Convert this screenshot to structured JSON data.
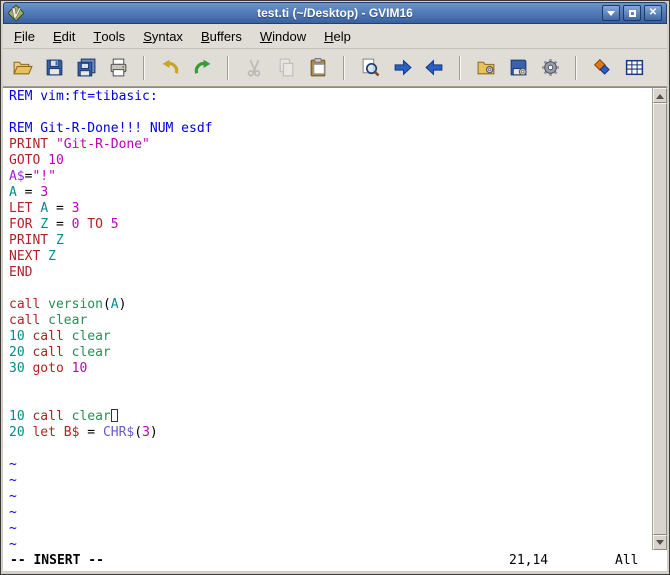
{
  "window": {
    "title": "test.ti (~/Desktop) - GVIM16",
    "controls": [
      "minimize",
      "maximize",
      "close"
    ]
  },
  "menu": {
    "items": [
      {
        "label": "File"
      },
      {
        "label": "Edit"
      },
      {
        "label": "Tools"
      },
      {
        "label": "Syntax"
      },
      {
        "label": "Buffers"
      },
      {
        "label": "Window"
      },
      {
        "label": "Help"
      }
    ]
  },
  "toolbar": {
    "icons": [
      "open-file-icon",
      "save-icon",
      "save-all-icon",
      "print-icon",
      "undo-icon",
      "redo-icon",
      "cut-icon",
      "copy-icon",
      "paste-icon",
      "find-replace-icon",
      "find-next-icon",
      "find-prev-icon",
      "load-session-icon",
      "save-session-icon",
      "run-script-icon",
      "make-icon",
      "table-icon"
    ]
  },
  "editor": {
    "cursor": {
      "line": 21,
      "col": 14
    },
    "tilde_rows": 6,
    "lines": [
      [
        {
          "t": "REM vim:ft=tibasic:",
          "c": "comment"
        }
      ],
      [],
      [
        {
          "t": "REM Git-R-Done!!! NUM esdf",
          "c": "comment"
        }
      ],
      [
        {
          "t": "PRINT ",
          "c": "statement"
        },
        {
          "t": "\"Git-R-Done\"",
          "c": "constant"
        }
      ],
      [
        {
          "t": "GOTO ",
          "c": "statement"
        },
        {
          "t": "10",
          "c": "constant"
        }
      ],
      [
        {
          "t": "A$",
          "c": "preproc"
        },
        {
          "t": "=",
          "c": "normal"
        },
        {
          "t": "\"!\"",
          "c": "constant"
        }
      ],
      [
        {
          "t": "A",
          "c": "identifier"
        },
        {
          "t": " = ",
          "c": "normal"
        },
        {
          "t": "3",
          "c": "constant"
        }
      ],
      [
        {
          "t": "LET ",
          "c": "statement"
        },
        {
          "t": "A",
          "c": "identifier"
        },
        {
          "t": " = ",
          "c": "normal"
        },
        {
          "t": "3",
          "c": "constant"
        }
      ],
      [
        {
          "t": "FOR ",
          "c": "statement"
        },
        {
          "t": "Z",
          "c": "identifier"
        },
        {
          "t": " = ",
          "c": "normal"
        },
        {
          "t": "0",
          "c": "constant"
        },
        {
          "t": " ",
          "c": "normal"
        },
        {
          "t": "TO ",
          "c": "statement"
        },
        {
          "t": "5",
          "c": "constant"
        }
      ],
      [
        {
          "t": "PRINT ",
          "c": "statement"
        },
        {
          "t": "Z",
          "c": "identifier"
        }
      ],
      [
        {
          "t": "NEXT ",
          "c": "statement"
        },
        {
          "t": "Z",
          "c": "identifier"
        }
      ],
      [
        {
          "t": "END",
          "c": "statement"
        }
      ],
      [],
      [
        {
          "t": "call ",
          "c": "statement"
        },
        {
          "t": "version",
          "c": "function"
        },
        {
          "t": "(",
          "c": "normal"
        },
        {
          "t": "A",
          "c": "identifier"
        },
        {
          "t": ")",
          "c": "normal"
        }
      ],
      [
        {
          "t": "call ",
          "c": "statement"
        },
        {
          "t": "clear",
          "c": "function"
        }
      ],
      [
        {
          "t": "10 ",
          "c": "identifier"
        },
        {
          "t": "call ",
          "c": "statement"
        },
        {
          "t": "clear",
          "c": "function"
        }
      ],
      [
        {
          "t": "20 ",
          "c": "identifier"
        },
        {
          "t": "call ",
          "c": "statement"
        },
        {
          "t": "clear",
          "c": "function"
        }
      ],
      [
        {
          "t": "30 ",
          "c": "identifier"
        },
        {
          "t": "goto ",
          "c": "statement"
        },
        {
          "t": "10",
          "c": "constant"
        }
      ],
      [],
      [],
      [
        {
          "t": "10 ",
          "c": "identifier"
        },
        {
          "t": "call ",
          "c": "statement"
        },
        {
          "t": "clear",
          "c": "function"
        },
        {
          "cursor": true
        }
      ],
      [
        {
          "t": "20 ",
          "c": "identifier"
        },
        {
          "t": "let ",
          "c": "statement"
        },
        {
          "t": "B$",
          "c": "statement"
        },
        {
          "t": " = ",
          "c": "normal"
        },
        {
          "t": "CHR$",
          "c": "special"
        },
        {
          "t": "(",
          "c": "normal"
        },
        {
          "t": "3",
          "c": "constant"
        },
        {
          "t": ")",
          "c": "normal"
        }
      ],
      []
    ]
  },
  "statusline": {
    "mode": "-- INSERT --",
    "ruler": "21,14",
    "scroll": "All"
  },
  "colors": {
    "comment": "#0000e0",
    "statement": "#b22222",
    "constant": "#bb00bb",
    "identifier": "#008b8b",
    "function": "#2e8b57",
    "preproc": "#a020f0",
    "special": "#6a5acd",
    "nontext": "#0000e0",
    "normal": "#000000",
    "titlebar_top": "#6b94cc",
    "titlebar_bottom": "#38619f",
    "chrome_bg": "#e0ddd6",
    "editor_bg": "#ffffff",
    "cursor_outline": "#333333"
  }
}
